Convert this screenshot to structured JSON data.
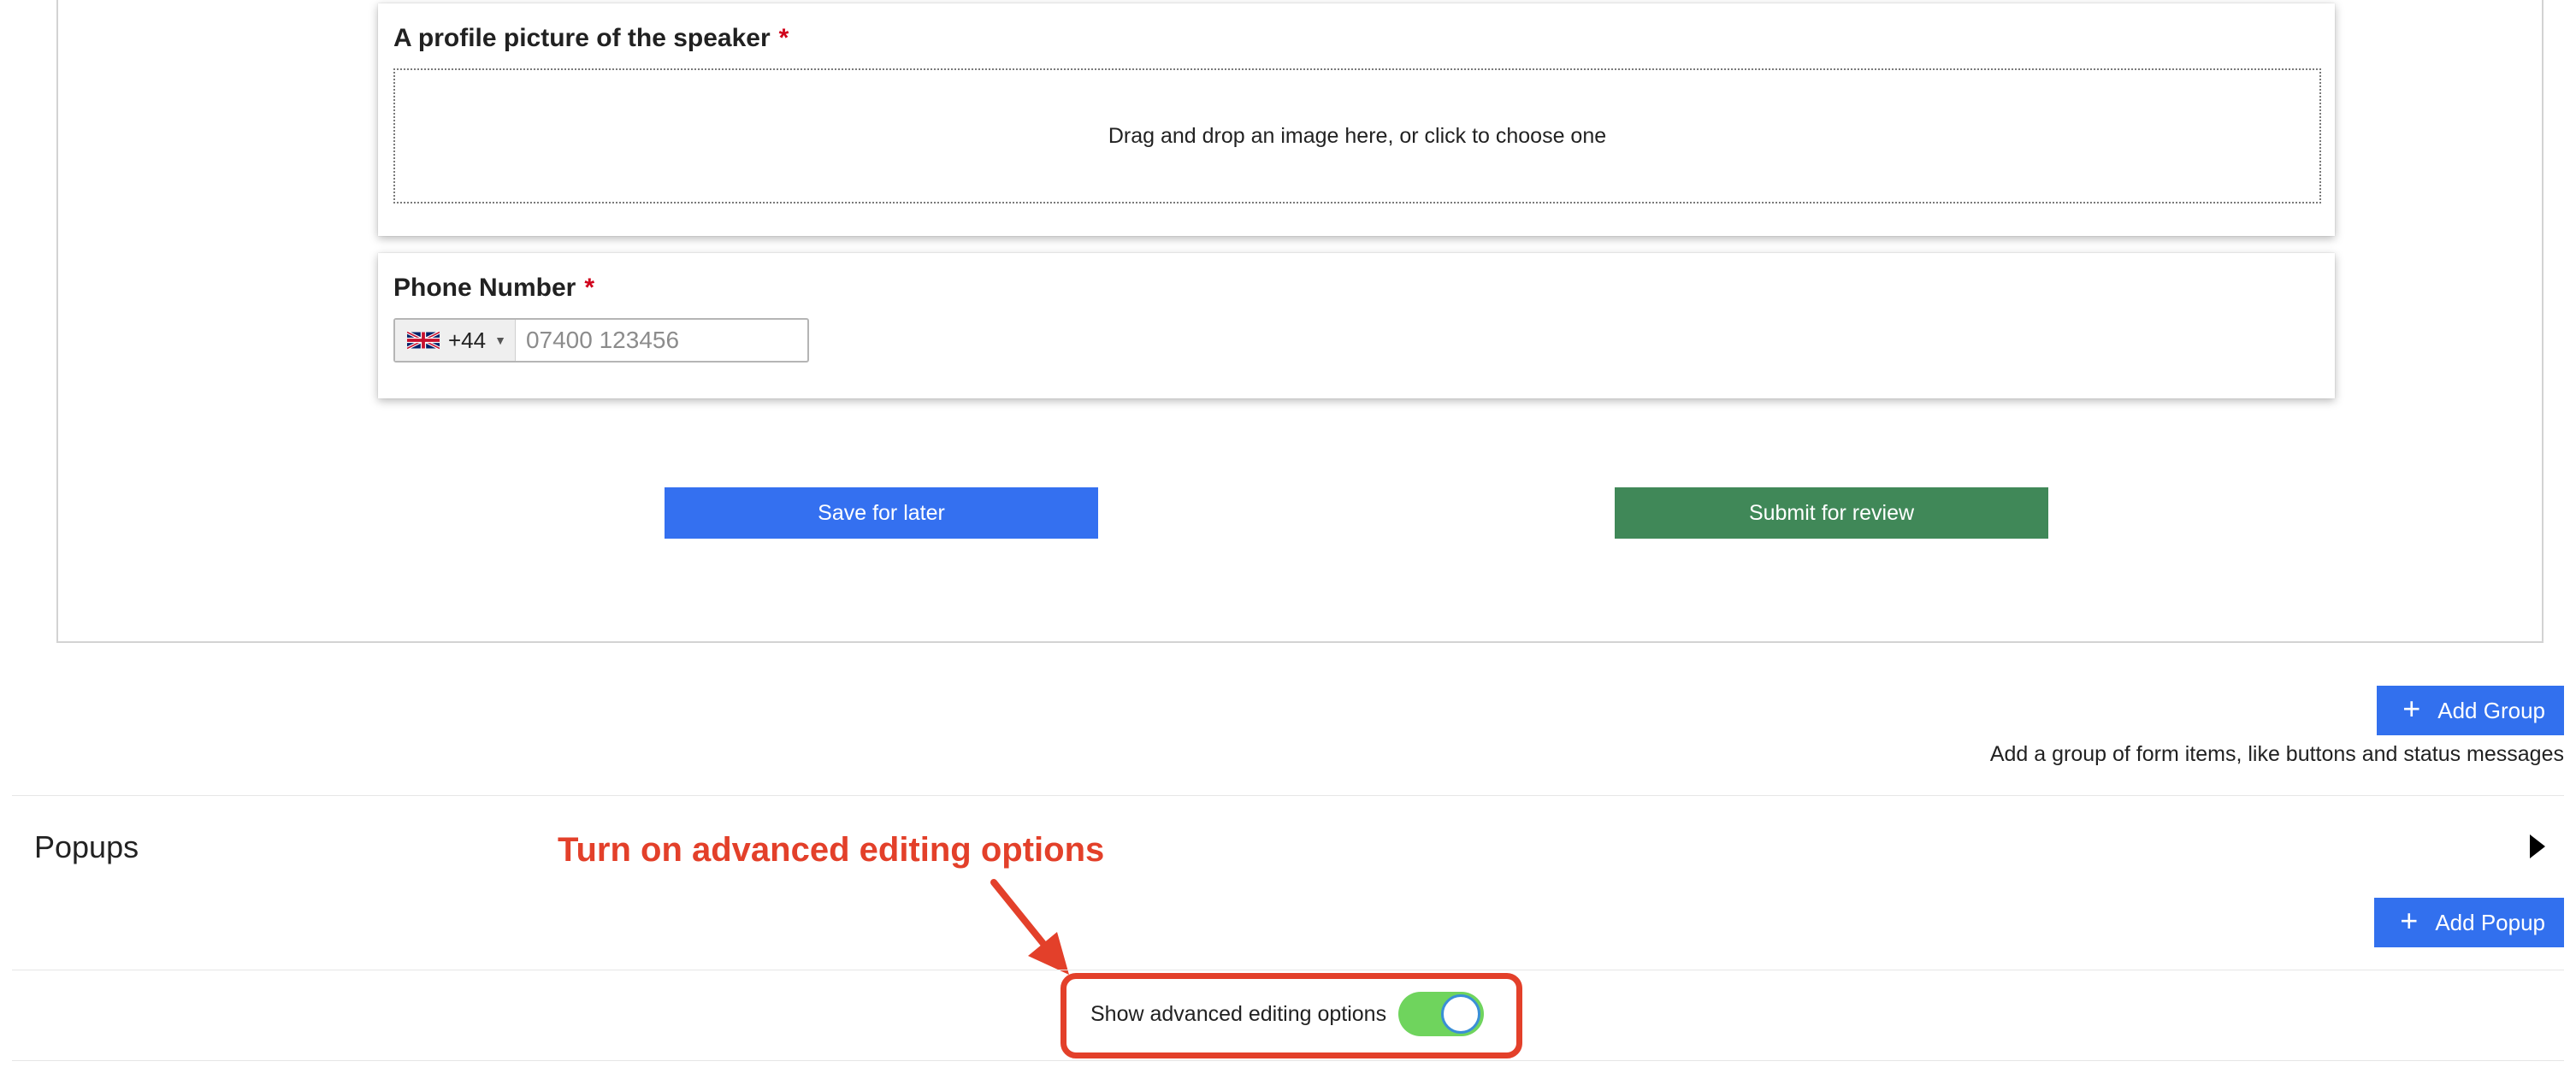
{
  "form": {
    "profile_picture": {
      "label": "A profile picture of the speaker",
      "required_marker": "*",
      "dropzone_text": "Drag and drop an image here, or click to choose one"
    },
    "phone": {
      "label": "Phone Number",
      "required_marker": "*",
      "country_code": "+44",
      "country_flag": "uk-flag-icon",
      "placeholder": "07400 123456"
    },
    "actions": {
      "save_label": "Save for later",
      "submit_label": "Submit for review"
    }
  },
  "groups": {
    "add_button_label": "Add Group",
    "helper_text": "Add a group of form items, like buttons and status messages"
  },
  "popups": {
    "title": "Popups",
    "add_button_label": "Add Popup"
  },
  "annotation": {
    "text": "Turn on advanced editing options"
  },
  "advanced_toggle": {
    "label": "Show advanced editing options",
    "enabled": true
  },
  "colors": {
    "primary": "#3470f0",
    "success": "#408858",
    "required": "#d0021b",
    "annotation": "#e3402a",
    "toggle_on": "#6fd45d"
  }
}
